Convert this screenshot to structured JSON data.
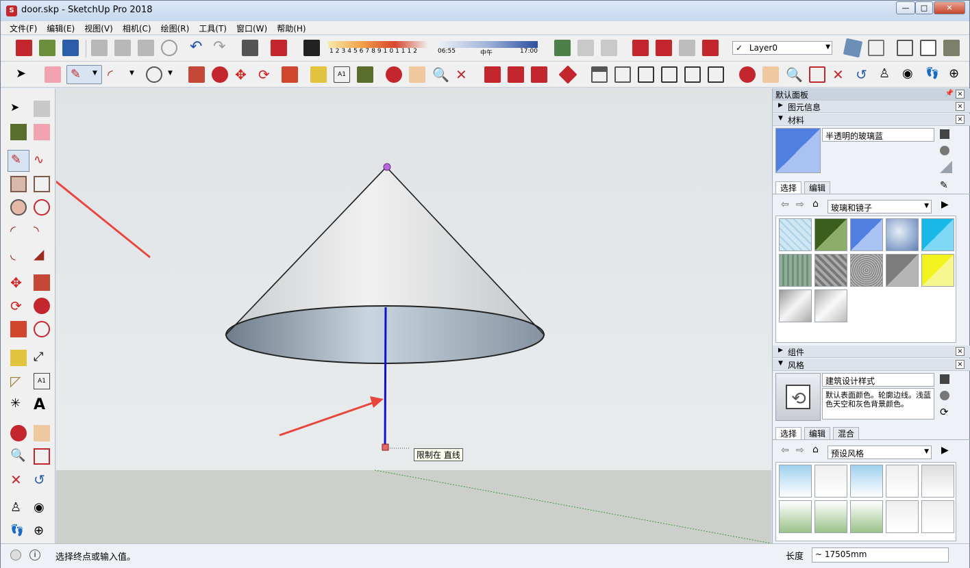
{
  "title": "door.skp - SketchUp Pro 2018",
  "window_buttons": {
    "minimize": "—",
    "maximize": "□",
    "close": "✕"
  },
  "menu": [
    "文件(F)",
    "编辑(E)",
    "视图(V)",
    "相机(C)",
    "绘图(R)",
    "工具(T)",
    "窗口(W)",
    "帮助(H)"
  ],
  "shadow": {
    "months": [
      "1",
      "2",
      "3",
      "4",
      "5",
      "6",
      "7",
      "8",
      "9",
      "10",
      "11",
      "12"
    ],
    "time_start": "06:55",
    "time_mid": "中午",
    "time_end": "17:00"
  },
  "layer": {
    "check": "✓",
    "name": "Layer0"
  },
  "tooltip": "限制在 直线",
  "tray": {
    "title": "默认面板",
    "entity_info": "图元信息",
    "materials": "材料",
    "material_name": "半透明的玻璃蓝",
    "mat_tab_select": "选择",
    "mat_tab_edit": "编辑",
    "mat_library": "玻璃和镜子",
    "components": "组件",
    "styles": "风格",
    "style_name": "建筑设计样式",
    "style_desc": "默认表面颜色。轮廓边线。浅蓝色天空和灰色背景颜色。",
    "style_tab_select": "选择",
    "style_tab_edit": "编辑",
    "style_tab_mix": "混合",
    "style_library": "预设风格"
  },
  "status": {
    "message": "选择终点或输入值。",
    "measure_label": "长度",
    "measure_value": "~ 17505mm"
  },
  "colors": {
    "accent": "#c4262e",
    "axis_blue": "#1010d0",
    "arrow_red": "#e8463c"
  }
}
